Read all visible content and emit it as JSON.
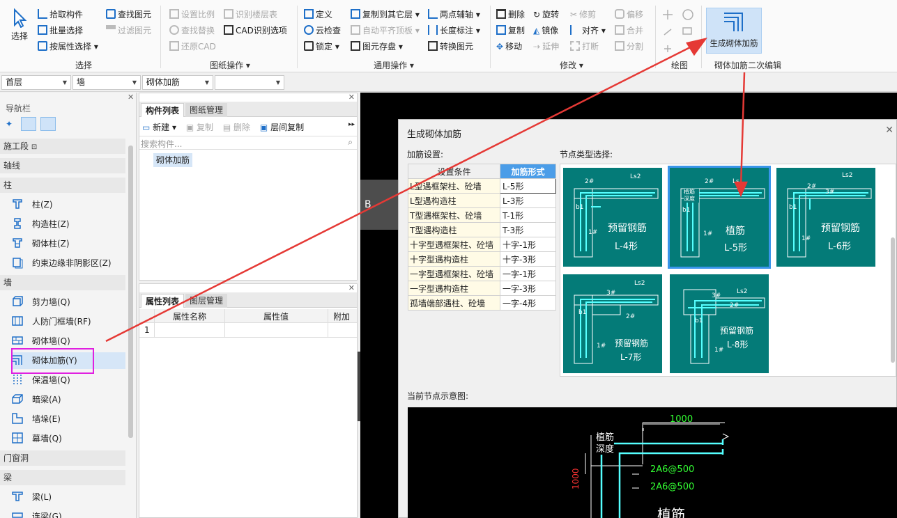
{
  "ribbon": {
    "select": "选择",
    "pick": "拾取构件",
    "batch": "批量选择",
    "byattr": "按属性选择",
    "findimg": "查找图元",
    "filterimg": "过滤图元",
    "setratio": "设置比例",
    "findreplace": "查找替换",
    "restorecad": "还原CAD",
    "floorid": "识别楼层表",
    "cadopts": "CAD识别选项",
    "define": "定义",
    "cloudcheck": "云检查",
    "lock": "锁定",
    "copyto": "复制到其它层",
    "autolevel": "自动平齐顶板",
    "savegraph": "图元存盘",
    "twopoint": "两点辅轴",
    "dimension": "长度标注",
    "convert": "转换图元",
    "delete": "删除",
    "copy": "复制",
    "move": "移动",
    "rotate": "旋转",
    "mirror": "镜像",
    "extend": "延伸",
    "trim": "修剪",
    "align": "对齐",
    "break": "打断",
    "offset": "偏移",
    "merge": "合并",
    "split": "分割",
    "gen": "生成砌体加筋",
    "g_select": "选择",
    "g_drawing": "图纸操作",
    "g_general": "通用操作",
    "g_modify": "修改",
    "g_draw": "绘图",
    "g_edit": "砌体加筋二次编辑"
  },
  "combos": {
    "floor": "首层",
    "type": "墙",
    "sub": "砌体加筋",
    "extra": ""
  },
  "nav": {
    "title": "导航栏",
    "sections": [
      "施工段",
      "轴线",
      "柱",
      "墙",
      "门窗洞",
      "梁"
    ],
    "items": [
      "柱(Z)",
      "构造柱(Z)",
      "砌体柱(Z)",
      "约束边缘非阴影区(Z)",
      "剪力墙(Q)",
      "人防门框墙(RF)",
      "砌体墙(Q)",
      "砌体加筋(Y)",
      "保温墙(Q)",
      "暗梁(A)",
      "墙垛(E)",
      "幕墙(Q)",
      "梁(L)",
      "连梁(G)"
    ]
  },
  "comp": {
    "tab1": "构件列表",
    "tab2": "图纸管理",
    "new": "新建",
    "copy": "复制",
    "del": "删除",
    "floorcopy": "层间复制",
    "search": "搜索构件...",
    "item": "砌体加筋"
  },
  "attr": {
    "tab1": "属性列表",
    "tab2": "图层管理",
    "col1": "属性名称",
    "col2": "属性值",
    "col3": "附加",
    "row1": "1"
  },
  "canvas": {
    "marker": "B"
  },
  "dialog": {
    "title": "生成砌体加筋",
    "setting": "加筋设置:",
    "nodesel": "节点类型选择:",
    "preview": "当前节点示意图:",
    "h1": "设置条件",
    "h2": "加筋形式",
    "rows": [
      [
        "L型遇框架柱、砼墙",
        "L-5形"
      ],
      [
        "L型遇构造柱",
        "L-3形"
      ],
      [
        "T型遇框架柱、砼墙",
        "T-1形"
      ],
      [
        "T型遇构造柱",
        "T-3形"
      ],
      [
        "十字型遇框架柱、砼墙",
        "十字-1形"
      ],
      [
        "十字型遇构造柱",
        "十字-3形"
      ],
      [
        "一字型遇框架柱、砼墙",
        "一字-1形"
      ],
      [
        "一字型遇构造柱",
        "一字-3形"
      ],
      [
        "孤墙端部遇柱、砼墙",
        "一字-4形"
      ]
    ],
    "cards": [
      {
        "t1": "预留钢筋",
        "t2": "L-4形",
        "a": "2#",
        "b": "Ls2",
        "c": "b1",
        "d": "1#"
      },
      {
        "t1": "植筋",
        "t2": "L-5形",
        "a": "2#",
        "b": "Ls",
        "c": "b1",
        "d": "1#",
        "e": "植筋深度"
      },
      {
        "t1": "预留钢筋",
        "t2": "L-6形",
        "a": "2#",
        "b": "Ls2",
        "c": "b1",
        "d": "1#",
        "f": "3#"
      },
      {
        "t1": "预留钢筋",
        "t2": "L-7形",
        "a": "2#",
        "b": "Ls2",
        "c": "b1",
        "d": "1#",
        "f": "3#"
      },
      {
        "t1": "预留钢筋",
        "t2": "L-8形",
        "a": "2#",
        "b": "Ls2",
        "c": "b1",
        "d": "1#",
        "f": "3#"
      }
    ],
    "pv": {
      "len": "1000",
      "e1": "植筋",
      "e2": "深度",
      "r1": "2A6@500",
      "r2": "2A6@500",
      "big": "植筋",
      "vert": "1000"
    }
  }
}
